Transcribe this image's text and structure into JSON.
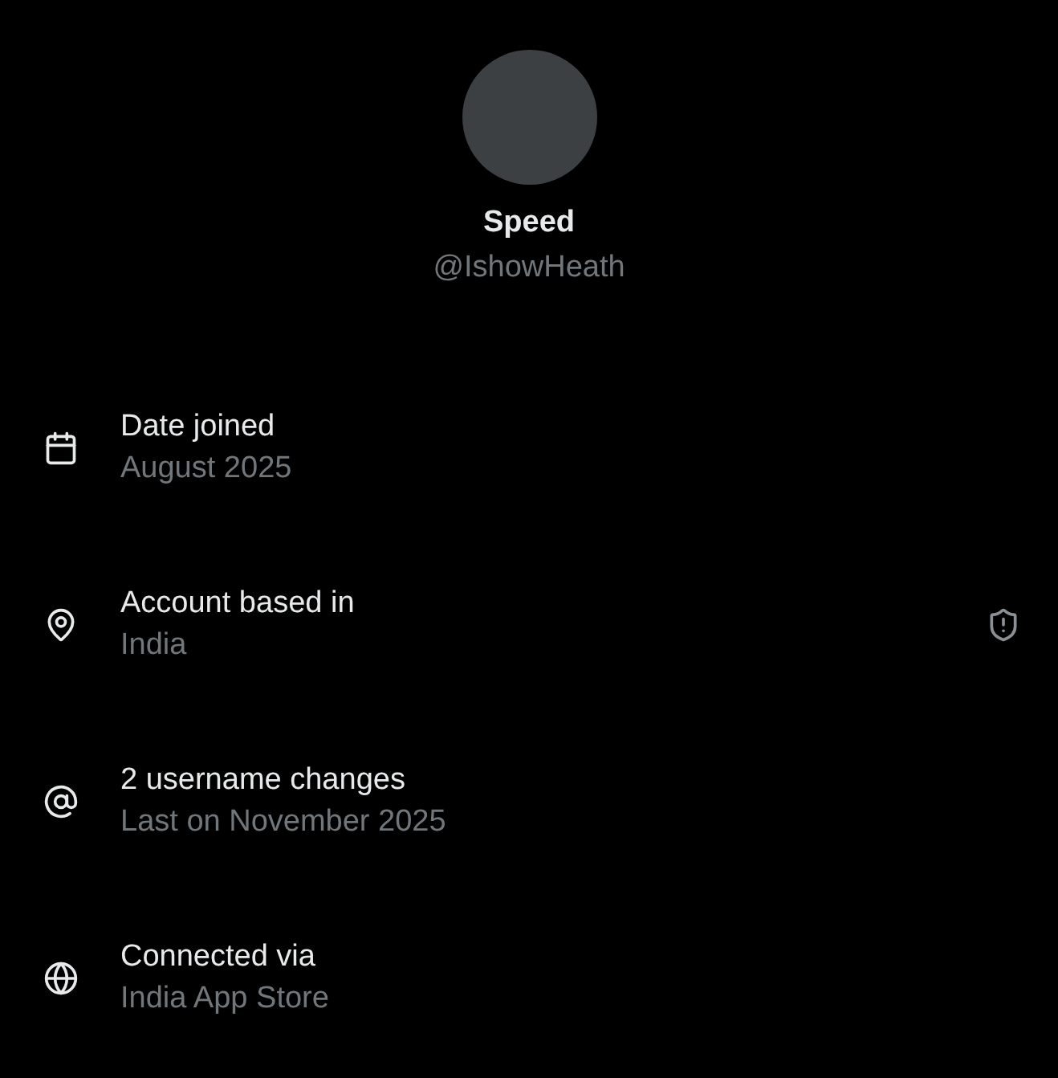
{
  "profile": {
    "name": "Speed",
    "handle": "@IshowHeath"
  },
  "details": [
    {
      "kind": "calendar",
      "title": "Date joined",
      "value": "August 2025",
      "flagged": false
    },
    {
      "kind": "location",
      "title": "Account based in",
      "value": "India",
      "flagged": true
    },
    {
      "kind": "at",
      "title": "2 username changes",
      "value": "Last on November 2025",
      "flagged": false
    },
    {
      "kind": "globe",
      "title": "Connected via",
      "value": "India App Store",
      "flagged": false
    }
  ]
}
